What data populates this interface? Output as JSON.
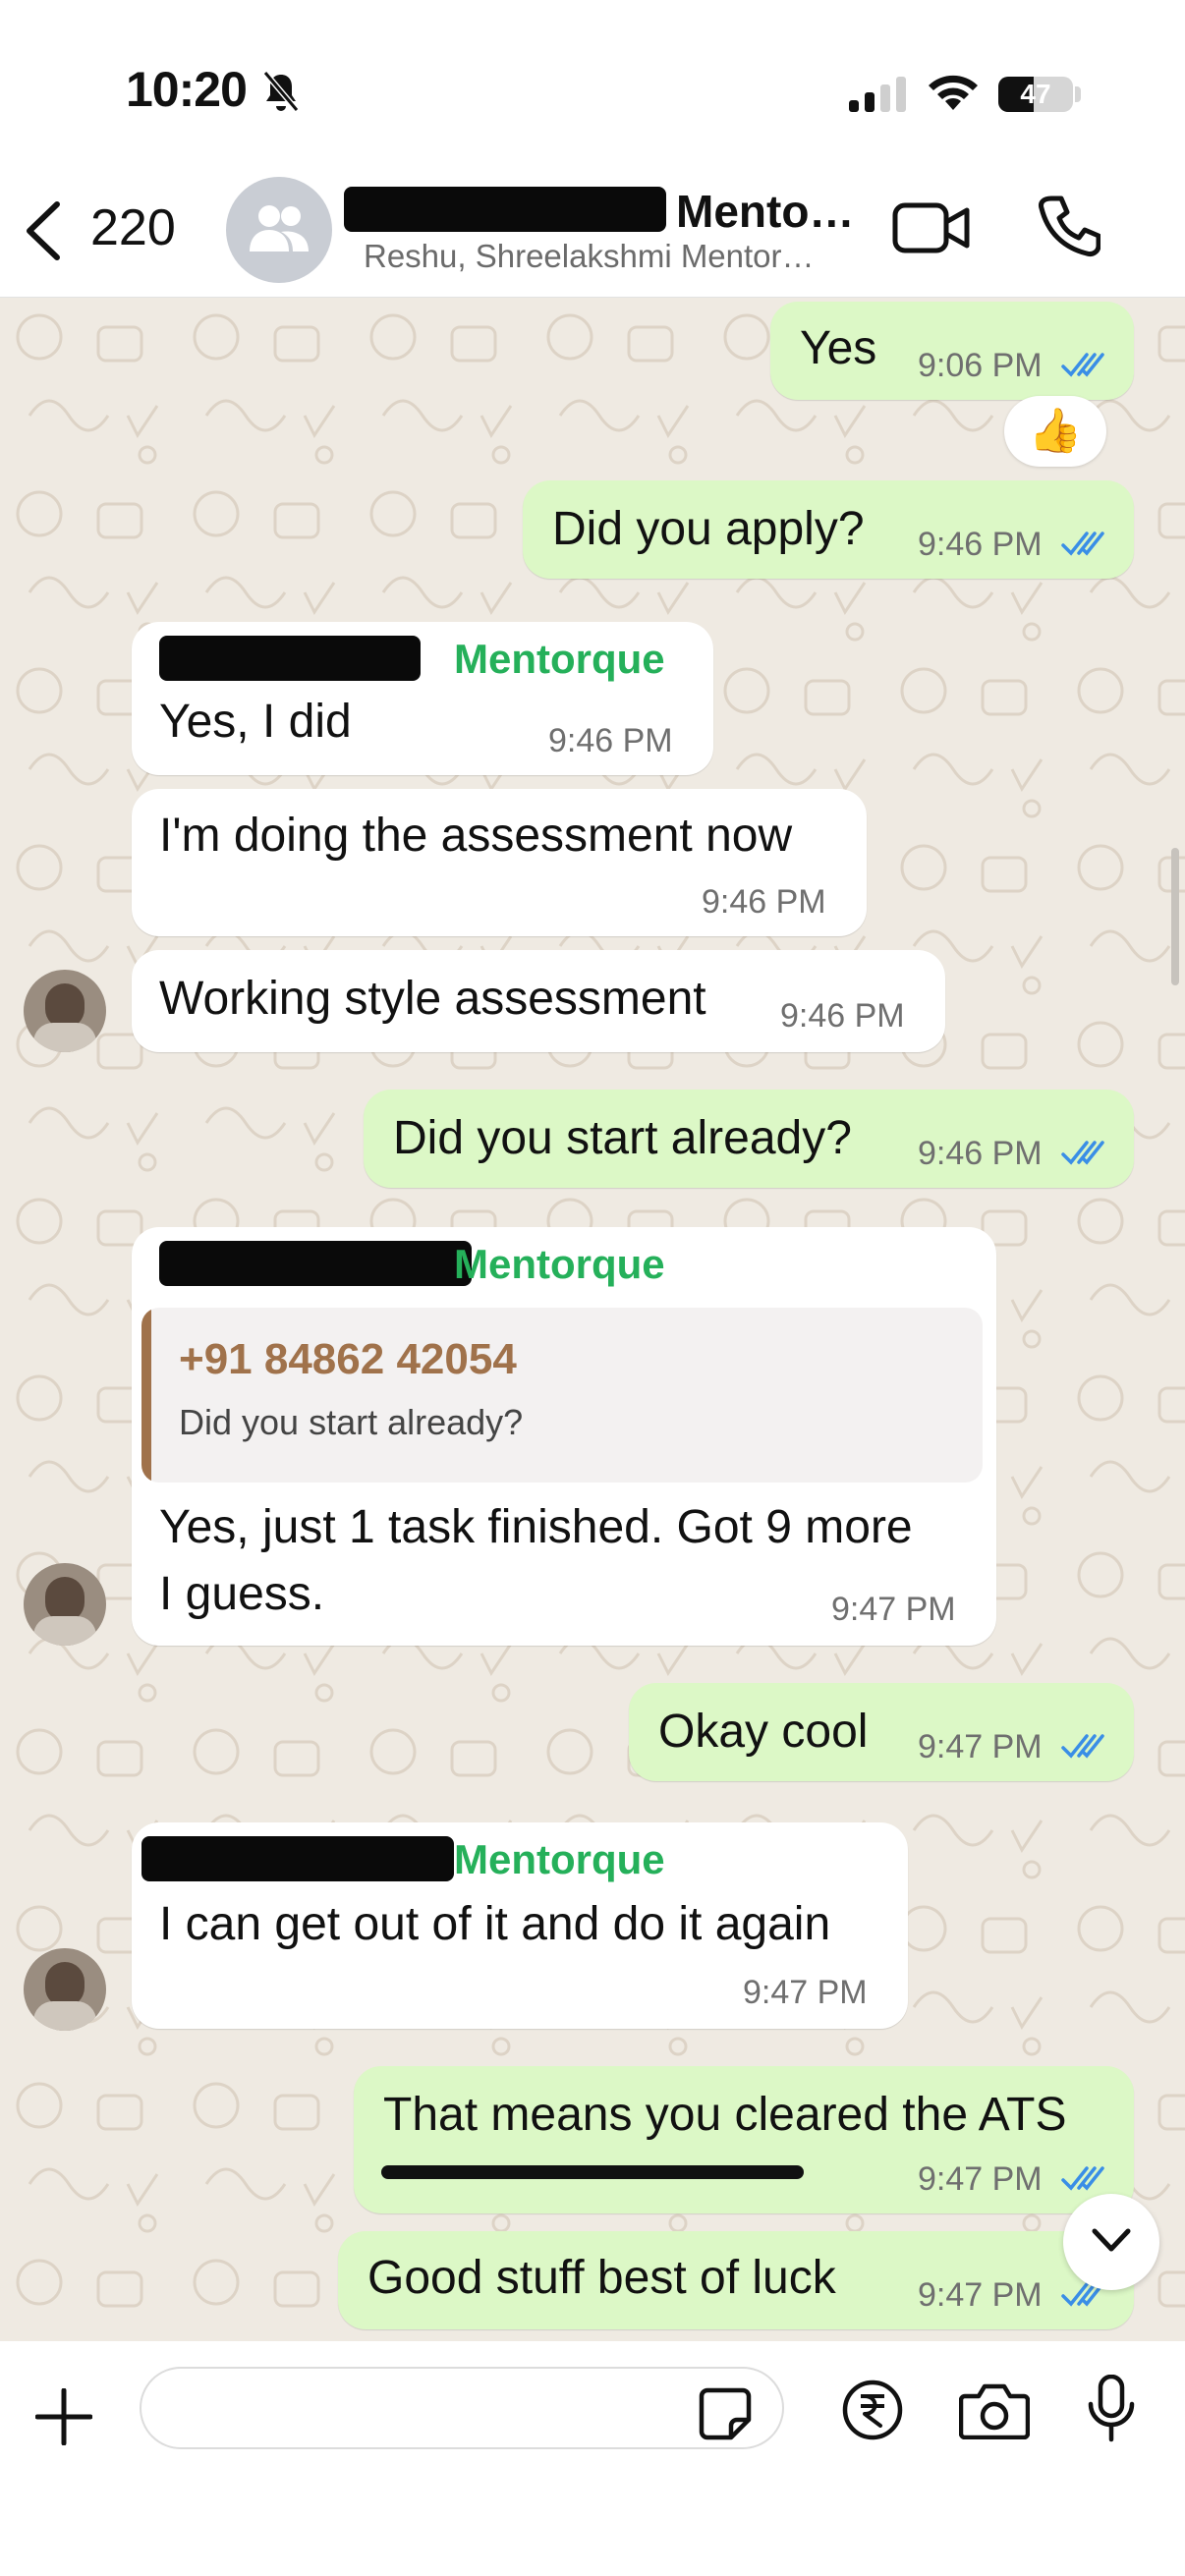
{
  "status_bar": {
    "time": "10:20",
    "battery": "47"
  },
  "header": {
    "back_count": "220",
    "title_visible": "Mento…",
    "subtitle": "Reshu, Shreelakshmi Mentor…",
    "title_redacted": "Shreelakshmi"
  },
  "messages": [
    {
      "dir": "out",
      "text": "Yes",
      "time": "9:06 PM",
      "read": true,
      "reaction": "👍"
    },
    {
      "dir": "out",
      "text": "Did you apply?",
      "time": "9:46 PM",
      "read": true
    },
    {
      "dir": "in",
      "sender": "Mentorque",
      "sender_redacted": "Shreelakshmi",
      "text": "Yes, I did",
      "time": "9:46 PM"
    },
    {
      "dir": "in",
      "text": "I'm doing the assessment now",
      "time": "9:46 PM"
    },
    {
      "dir": "in",
      "text": "Working style assessment",
      "time": "9:46 PM"
    },
    {
      "dir": "out",
      "text": "Did you start already?",
      "time": "9:46 PM",
      "read": true
    },
    {
      "dir": "in",
      "sender": "Mentorque",
      "sender_redacted": "Shreelakshmi",
      "quote_name": "+91 84862 42054",
      "quote_text": "Did you start already?",
      "text_line1": "Yes, just 1 task finished. Got 9 more",
      "text_line2": "I guess.",
      "time": "9:47 PM"
    },
    {
      "dir": "out",
      "text": "Okay cool",
      "time": "9:47 PM",
      "read": true
    },
    {
      "dir": "in",
      "sender": "Mentorque",
      "sender_redacted": "Shreelakshmi",
      "text": "I can get out of it and do it again",
      "time": "9:47 PM"
    },
    {
      "dir": "out",
      "text": "That means you cleared the ATS",
      "time": "9:47 PM",
      "read": true
    },
    {
      "dir": "out",
      "text": "Good stuff best of luck",
      "time": "9:47 PM",
      "read": true
    }
  ],
  "input": {
    "placeholder": ""
  },
  "icons": [
    "back-icon",
    "group-avatar-icon",
    "video-call-icon",
    "voice-call-icon",
    "double-check-icon",
    "scroll-down-icon",
    "plus-icon",
    "sticker-icon",
    "rupee-payment-icon",
    "camera-icon",
    "mic-icon"
  ],
  "colors": {
    "outgoing": "#dcf8c6",
    "incoming": "#ffffff",
    "sender": "#25b05a",
    "tick": "#3a8ee6",
    "quote": "#a0724b"
  }
}
